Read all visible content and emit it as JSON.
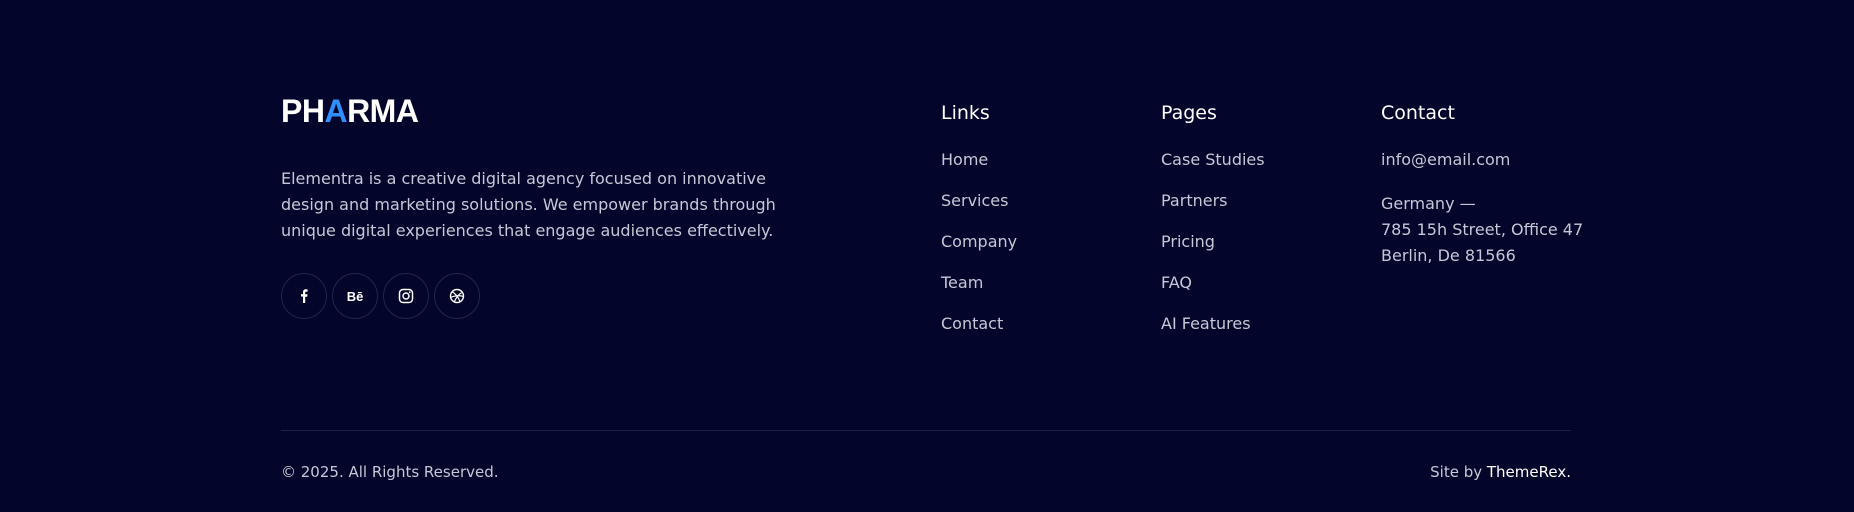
{
  "brand": {
    "logo_part1": "PH",
    "logo_accent": "A",
    "logo_part2": "RMA",
    "description": "Elementra is a creative digital agency focused on innovative design and marketing solutions. We empower brands through unique digital experiences that engage audiences effectively."
  },
  "social": [
    {
      "icon": "facebook-icon"
    },
    {
      "icon": "behance-icon",
      "glyph": "Bē"
    },
    {
      "icon": "instagram-icon"
    },
    {
      "icon": "dribbble-icon"
    }
  ],
  "links": {
    "title": "Links",
    "items": [
      "Home",
      "Services",
      "Company",
      "Team",
      "Contact"
    ]
  },
  "pages": {
    "title": "Pages",
    "items": [
      "Case Studies",
      "Partners",
      "Pricing",
      "FAQ",
      "AI Features"
    ]
  },
  "contact": {
    "title": "Contact",
    "email": "info@email.com",
    "address": [
      "Germany —",
      "785 15h Street, Office 47",
      "Berlin, De 81566"
    ]
  },
  "bottom": {
    "copyright": "© 2025. All Rights Reserved.",
    "credit_prefix": "Site by",
    "credit_brand": "ThemeRex."
  },
  "colors": {
    "background": "#03052a",
    "accent": "#2f8fff",
    "text": "#c5c8d6",
    "heading": "#ffffff",
    "divider": "#1f2248"
  }
}
